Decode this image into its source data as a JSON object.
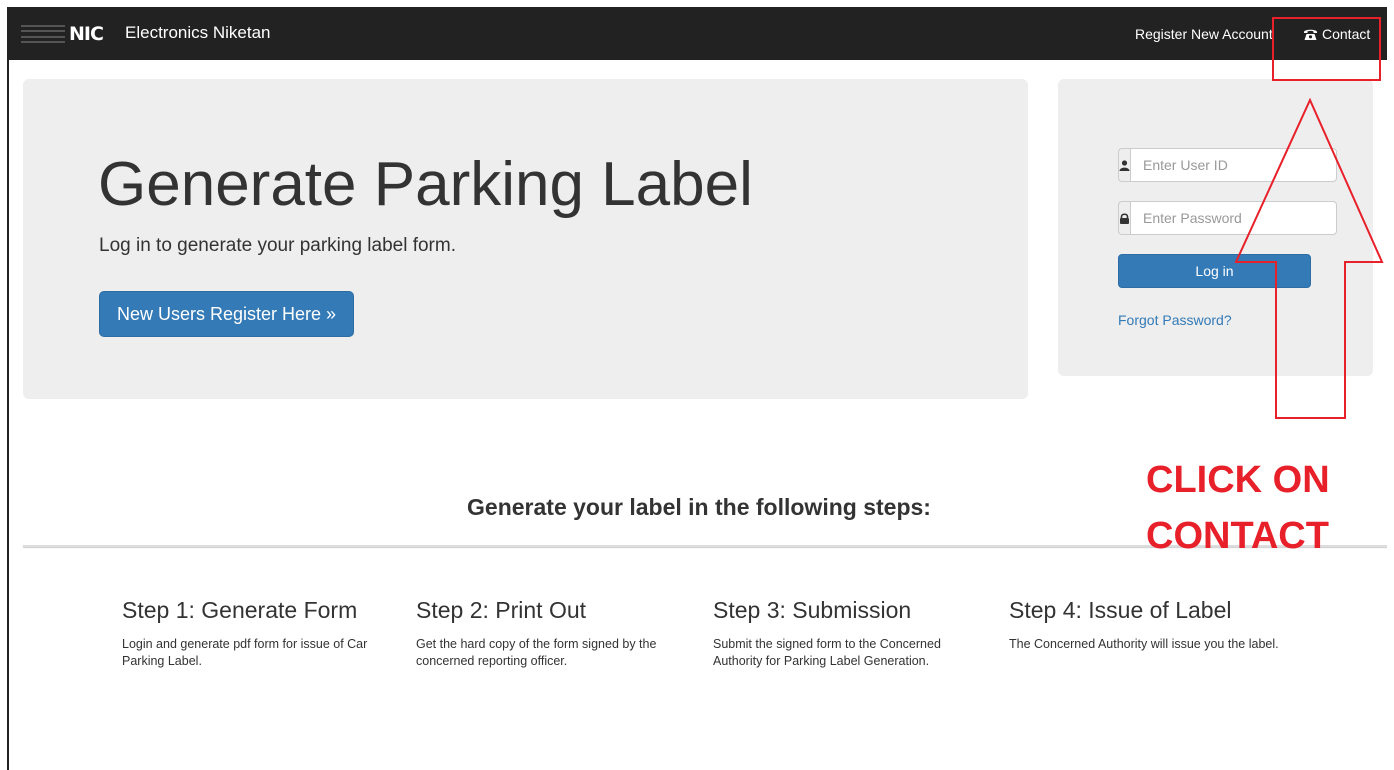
{
  "navbar": {
    "brand": "Electronics Niketan",
    "logo_text": "NIC",
    "register_link": "Register New Account",
    "contact_link": "Contact",
    "contact_icon": "phone-icon"
  },
  "jumbotron": {
    "title": "Generate Parking Label",
    "subtitle": "Log in to generate your parking label form.",
    "register_button": "New Users Register Here »"
  },
  "login": {
    "user_icon": "user-icon",
    "user_placeholder": "Enter User ID",
    "password_icon": "lock-icon",
    "password_placeholder": "Enter Password",
    "login_button": "Log in",
    "forgot_link": "Forgot Password?"
  },
  "steps": {
    "heading": "Generate your label in the following steps:",
    "items": [
      {
        "title": "Step 1: Generate Form",
        "text": "Login and generate pdf form for issue of Car Parking Label."
      },
      {
        "title": "Step 2: Print Out",
        "text": "Get the hard copy of the form signed by the concerned reporting officer."
      },
      {
        "title": "Step 3: Submission",
        "text": "Submit the signed form to the Concerned Authority for Parking Label Generation."
      },
      {
        "title": "Step 4: Issue of Label",
        "text": "The Concerned Authority will issue you the label."
      }
    ]
  },
  "annotation": {
    "line1": "CLICK ON",
    "line2": "CONTACT",
    "color": "#e8202a"
  },
  "colors": {
    "navbar": "#222222",
    "primary": "#337ab7",
    "panel": "#eeeeee"
  }
}
